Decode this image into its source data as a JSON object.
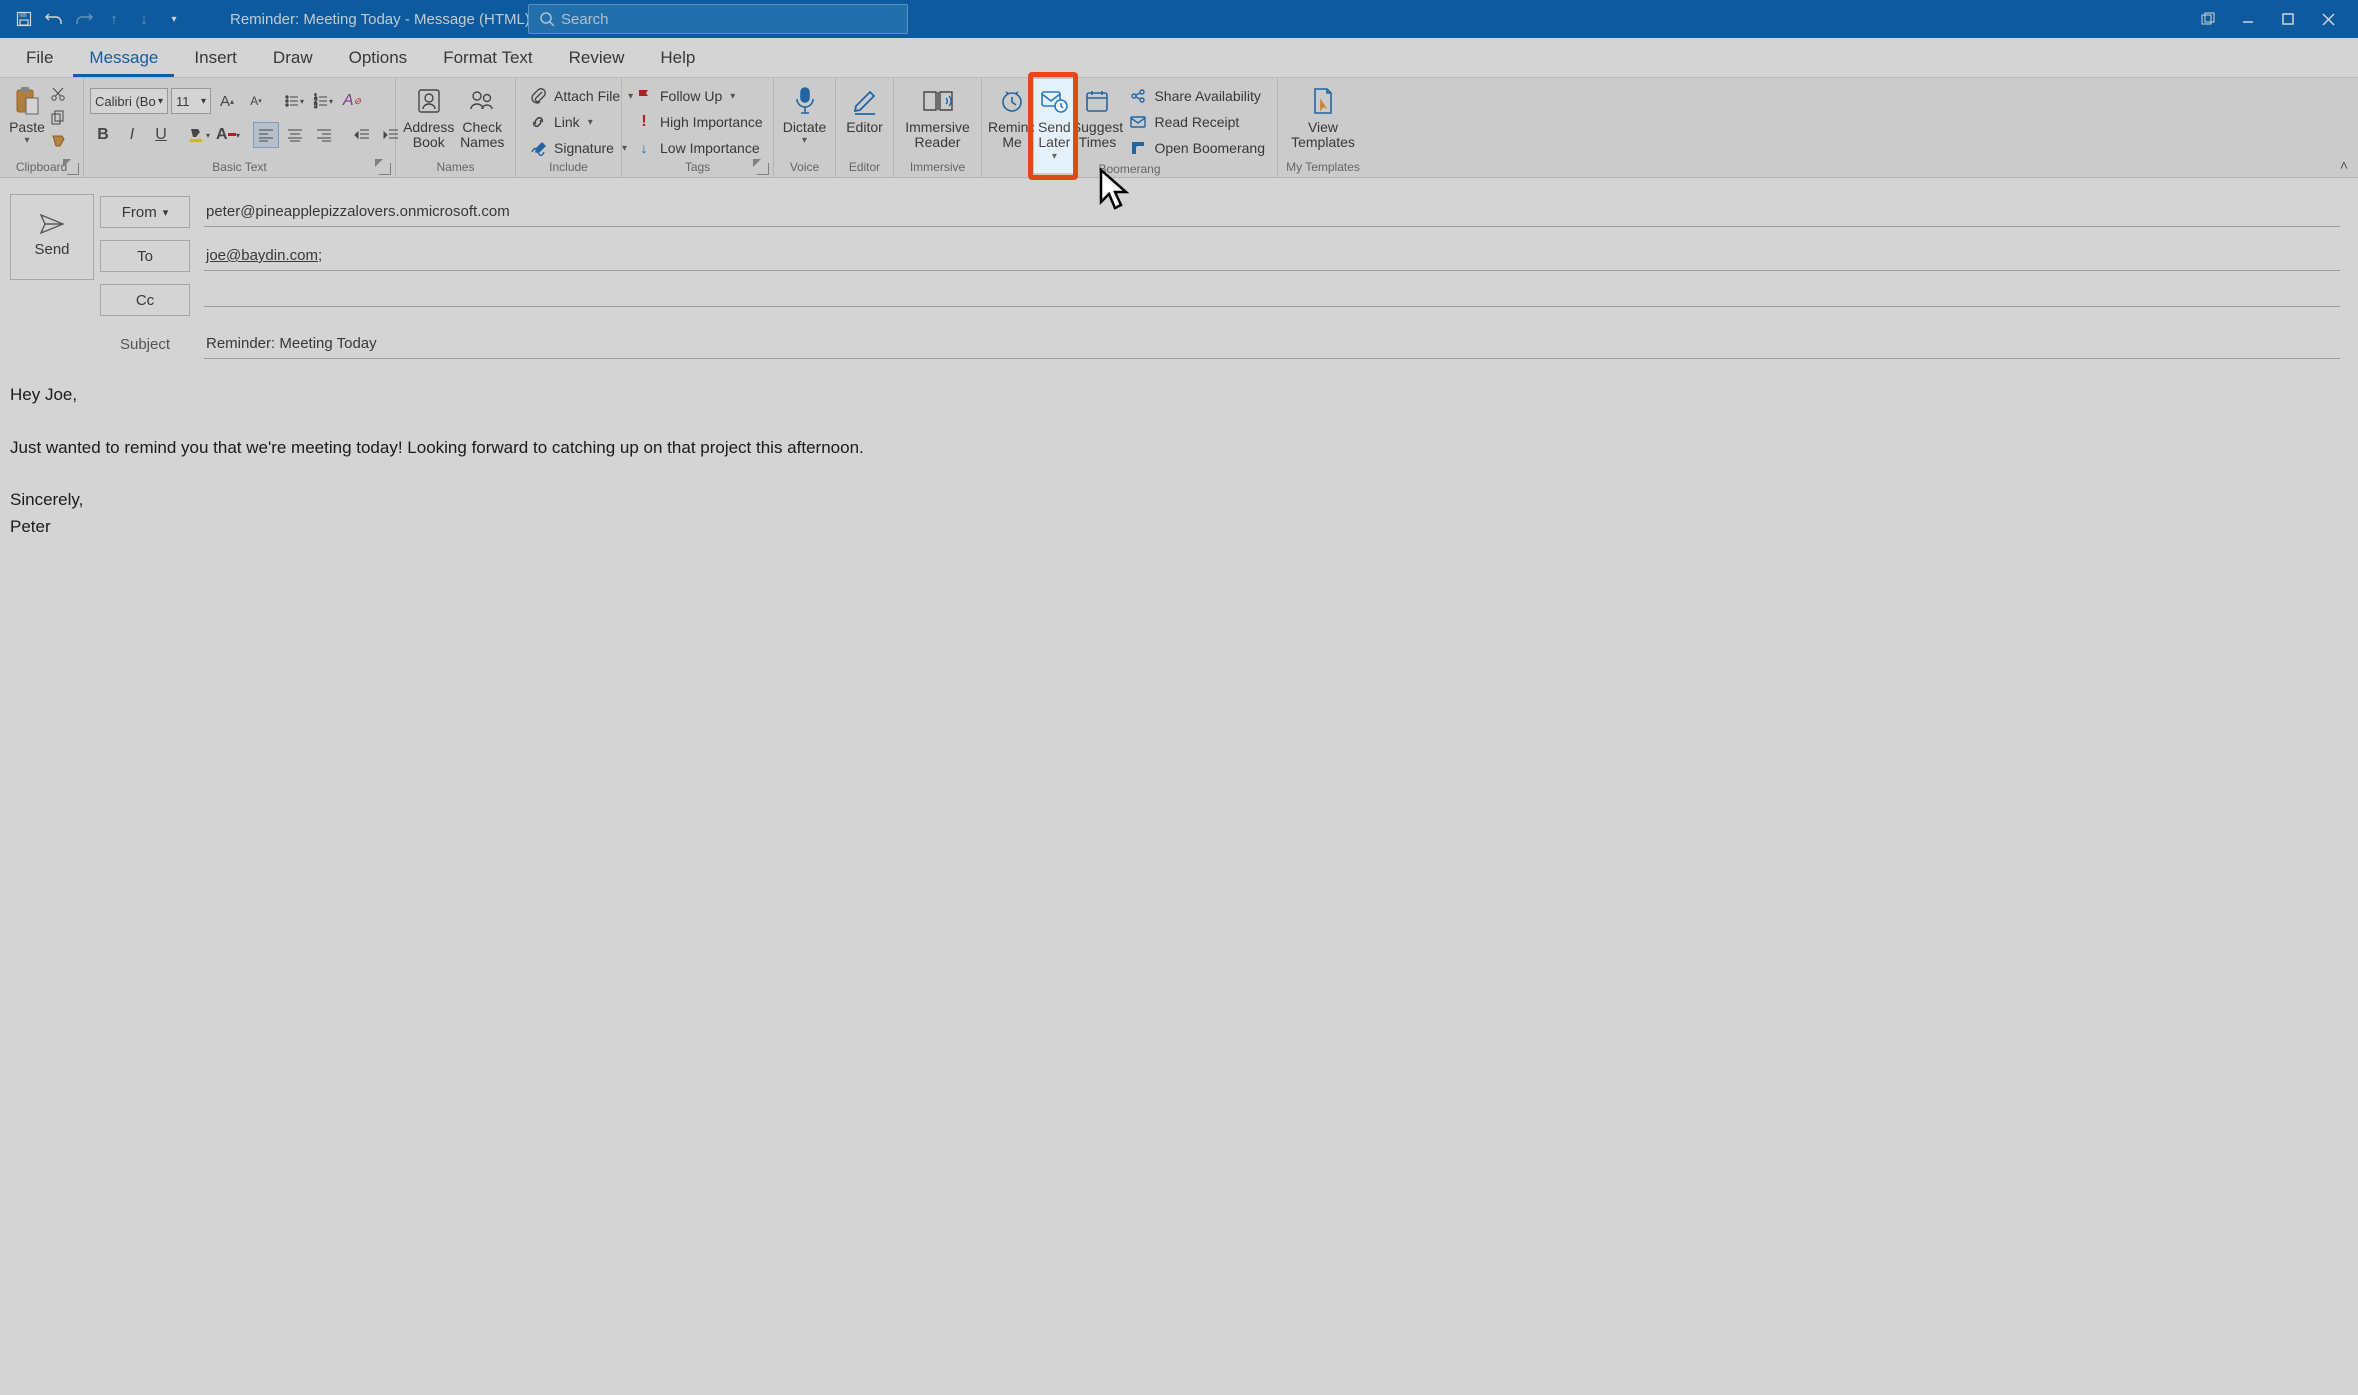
{
  "titlebar": {
    "title": "Reminder: Meeting Today  -  Message (HTML)",
    "search_placeholder": "Search"
  },
  "tabs": {
    "file": "File",
    "message": "Message",
    "insert": "Insert",
    "draw": "Draw",
    "options": "Options",
    "format_text": "Format Text",
    "review": "Review",
    "help": "Help"
  },
  "ribbon": {
    "clipboard": {
      "label": "Clipboard",
      "paste": "Paste"
    },
    "basic_text": {
      "label": "Basic Text",
      "font_name": "Calibri (Bo",
      "font_size": "11"
    },
    "names": {
      "label": "Names",
      "address_book": "Address\nBook",
      "check_names": "Check\nNames"
    },
    "include": {
      "label": "Include",
      "attach_file": "Attach File",
      "link": "Link",
      "signature": "Signature"
    },
    "tags": {
      "label": "Tags",
      "follow_up": "Follow Up",
      "high_importance": "High Importance",
      "low_importance": "Low Importance"
    },
    "voice": {
      "label": "Voice",
      "dictate": "Dictate"
    },
    "editor": {
      "label": "Editor",
      "editor": "Editor"
    },
    "immersive": {
      "label": "Immersive",
      "immersive_reader": "Immersive\nReader"
    },
    "boomerang": {
      "label": "Boomerang",
      "remind_me": "Remind\nMe",
      "send_later": "Send\nLater",
      "suggest_times": "Suggest\nTimes",
      "share_availability": "Share Availability",
      "read_receipt": "Read Receipt",
      "open_boomerang": "Open Boomerang"
    },
    "my_templates": {
      "label": "My Templates",
      "view_templates": "View\nTemplates"
    }
  },
  "compose": {
    "send": "Send",
    "from_label": "From",
    "from_value": "peter@pineapplepizzalovers.onmicrosoft.com",
    "to_label": "To",
    "to_value": "joe@baydin.com",
    "cc_label": "Cc",
    "cc_value": "",
    "subject_label": "Subject",
    "subject_value": "Reminder: Meeting Today",
    "body_line1": "Hey Joe,",
    "body_line2": "Just wanted to remind you that we're meeting today! Looking forward to catching up on that project this afternoon.",
    "body_line3": "Sincerely,",
    "body_line4": "Peter"
  }
}
